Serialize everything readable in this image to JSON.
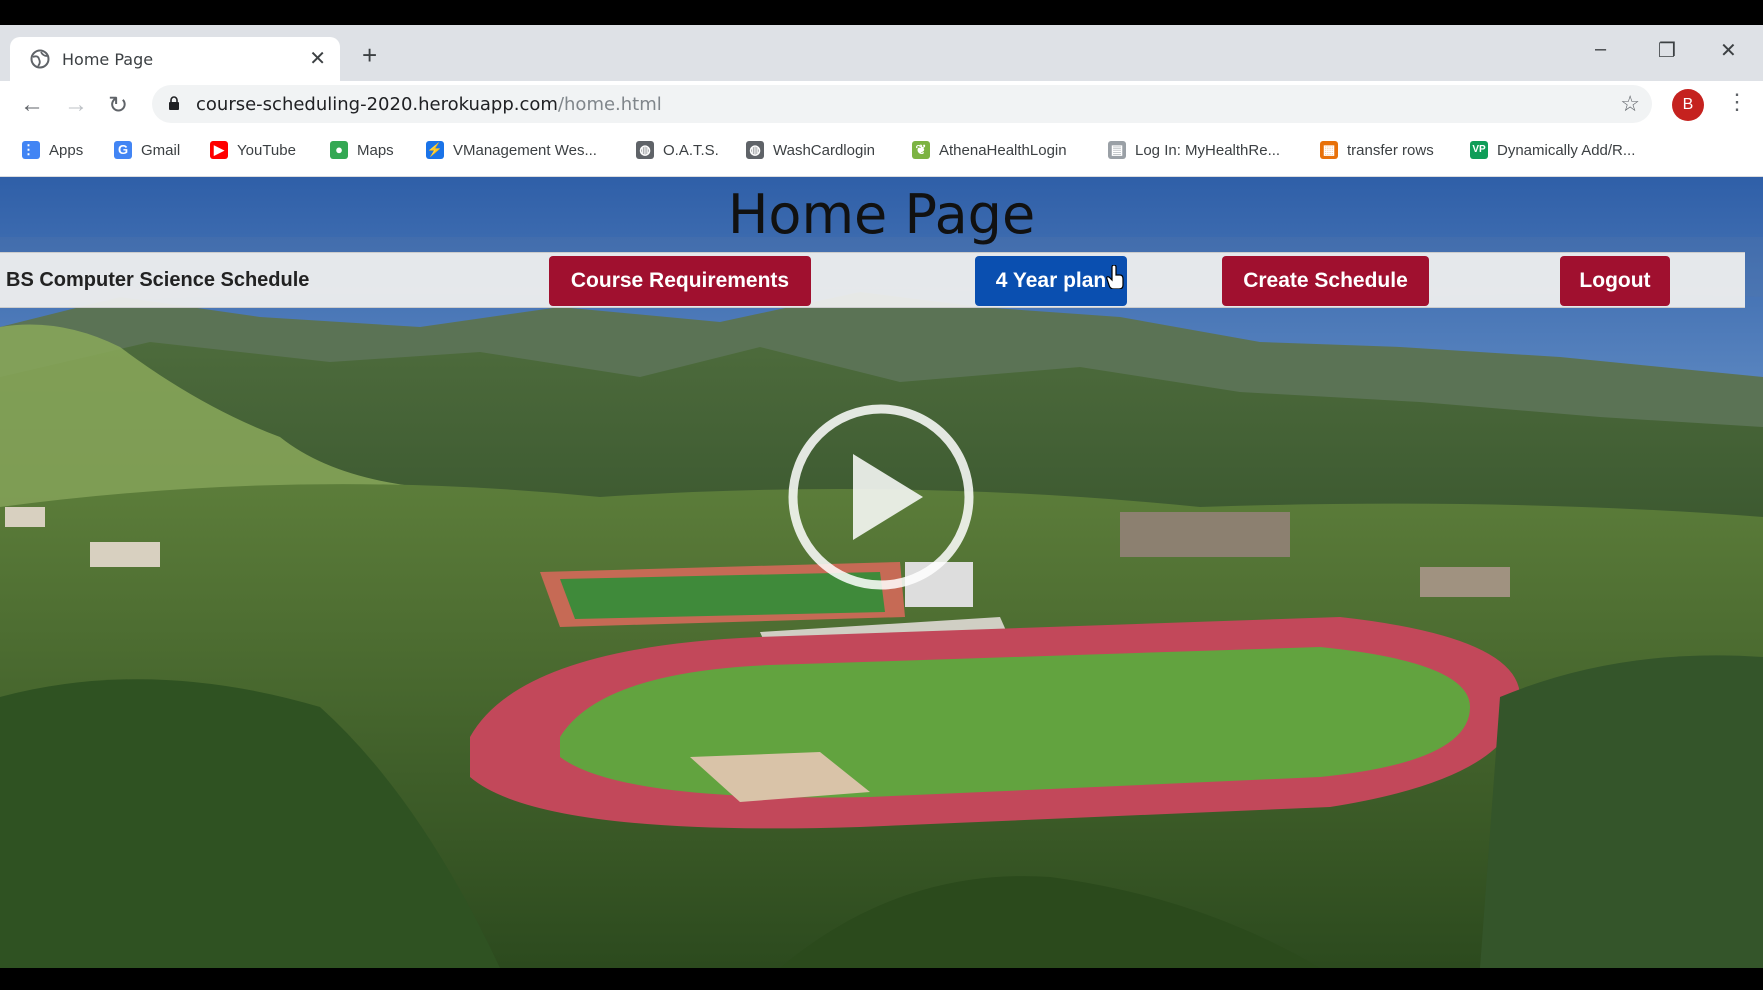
{
  "browser": {
    "tab_title": "Home Page",
    "new_tab_symbol": "+",
    "close_symbol": "✕",
    "minimize_symbol": "–",
    "restore_symbol": "❐",
    "window_close_symbol": "✕",
    "url_host": "course-scheduling-2020.herokuapp.com",
    "url_path": "/home.html",
    "avatar_letter": "B",
    "bookmarks": [
      {
        "label": "Apps",
        "icon": "apps-grid-icon",
        "color": "#4285f4"
      },
      {
        "label": "Gmail",
        "icon": "google-g-icon",
        "color": "#4285f4"
      },
      {
        "label": "YouTube",
        "icon": "youtube-icon",
        "color": "#ff0000"
      },
      {
        "label": "Maps",
        "icon": "maps-pin-icon",
        "color": "#34a853"
      },
      {
        "label": "VManagement Wes...",
        "icon": "lightning-icon",
        "color": "#1a73e8"
      },
      {
        "label": "O.A.T.S.",
        "icon": "globe-icon",
        "color": "#5f6368"
      },
      {
        "label": "WashCardlogin",
        "icon": "globe-icon",
        "color": "#5f6368"
      },
      {
        "label": "AthenaHealthLogin",
        "icon": "leaf-icon",
        "color": "#7cb342"
      },
      {
        "label": "Log In: MyHealthRe...",
        "icon": "page-icon",
        "color": "#9aa0a6"
      },
      {
        "label": "transfer rows",
        "icon": "sheet-icon",
        "color": "#e8710a"
      },
      {
        "label": "Dynamically Add/R...",
        "icon": "vp-icon",
        "color": "#0f9d58"
      }
    ]
  },
  "page": {
    "title": "Home Page",
    "brand": "BS Computer Science Schedule",
    "buttons": {
      "course_requirements": "Course Requirements",
      "four_year_plan": "4 Year plan",
      "create_schedule": "Create Schedule",
      "logout": "Logout"
    },
    "colors": {
      "primary_button": "#a0102f",
      "active_button": "#0a4fb0"
    }
  }
}
